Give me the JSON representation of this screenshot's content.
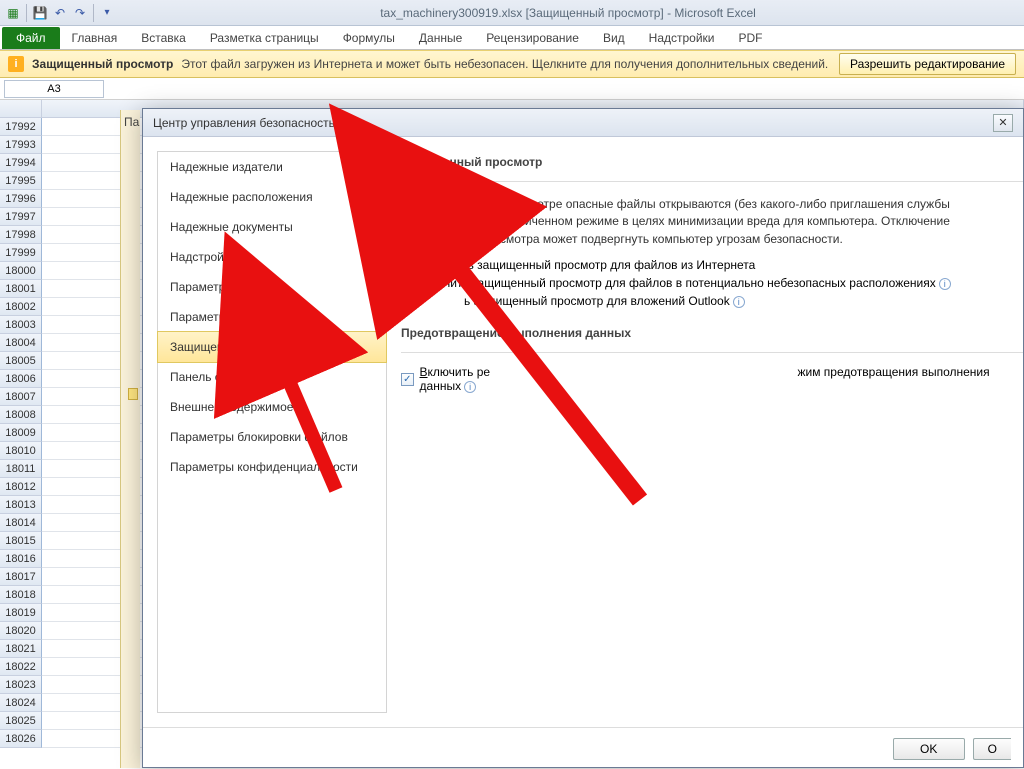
{
  "title": "tax_machinery300919.xlsx  [Защищенный просмотр]  -  Microsoft Excel",
  "ribbon": {
    "file": "Файл",
    "tabs": [
      "Главная",
      "Вставка",
      "Разметка страницы",
      "Формулы",
      "Данные",
      "Рецензирование",
      "Вид",
      "Надстройки",
      "PDF"
    ]
  },
  "warn": {
    "title": "Защищенный просмотр",
    "text": "Этот файл загружен из Интернета и может быть небезопасен. Щелкните для получения дополнительных сведений.",
    "button": "Разрешить редактирование"
  },
  "namebox": "A3",
  "partial_panel_label": "Па",
  "rows": [
    "17992",
    "17993",
    "17994",
    "17995",
    "17996",
    "17997",
    "17998",
    "17999",
    "18000",
    "18001",
    "18002",
    "18003",
    "18004",
    "18005",
    "18006",
    "18007",
    "18008",
    "18009",
    "18010",
    "18011",
    "18012",
    "18013",
    "18014",
    "18015",
    "18016",
    "18017",
    "18018",
    "18019",
    "18020",
    "18021",
    "18022",
    "18023",
    "18024",
    "18025",
    "18026"
  ],
  "dialog": {
    "title": "Центр управления безопасностью",
    "nav": [
      "Надежные издатели",
      "Надежные расположения",
      "Надежные документы",
      "Надстройки",
      "Параметры ActiveX",
      "Параметры макросов",
      "Защищенный просмотр",
      "Панель сообщений",
      "Внешнее содержимое",
      "Параметры блокировки файлов",
      "Параметры конфиденциальности"
    ],
    "nav_selected": 6,
    "sect1_title": "Защищенный просмотр",
    "sect1_text": "При защищенном просмотре опасные файлы открываются (без какого-либо приглашения службы безопасности) в ограниченном режиме в целях минимизации вреда для компьютера. Отключение защищенного просмотра может подвергнуть компьютер угрозам безопасности.",
    "chk1": "Включить защищенный просмотр для файлов из Интернета",
    "chk2_a": "чить защищенный просмотр для файлов в потенциально небезопасных расположениях",
    "chk3_a": "ь защищенный просмотр для вложений Outlook",
    "sect2_title": "Предотвращение выполнения данных",
    "chk4": "Включить режим предотвращения выполнения данных",
    "ok": "OK",
    "cancel": "О"
  }
}
